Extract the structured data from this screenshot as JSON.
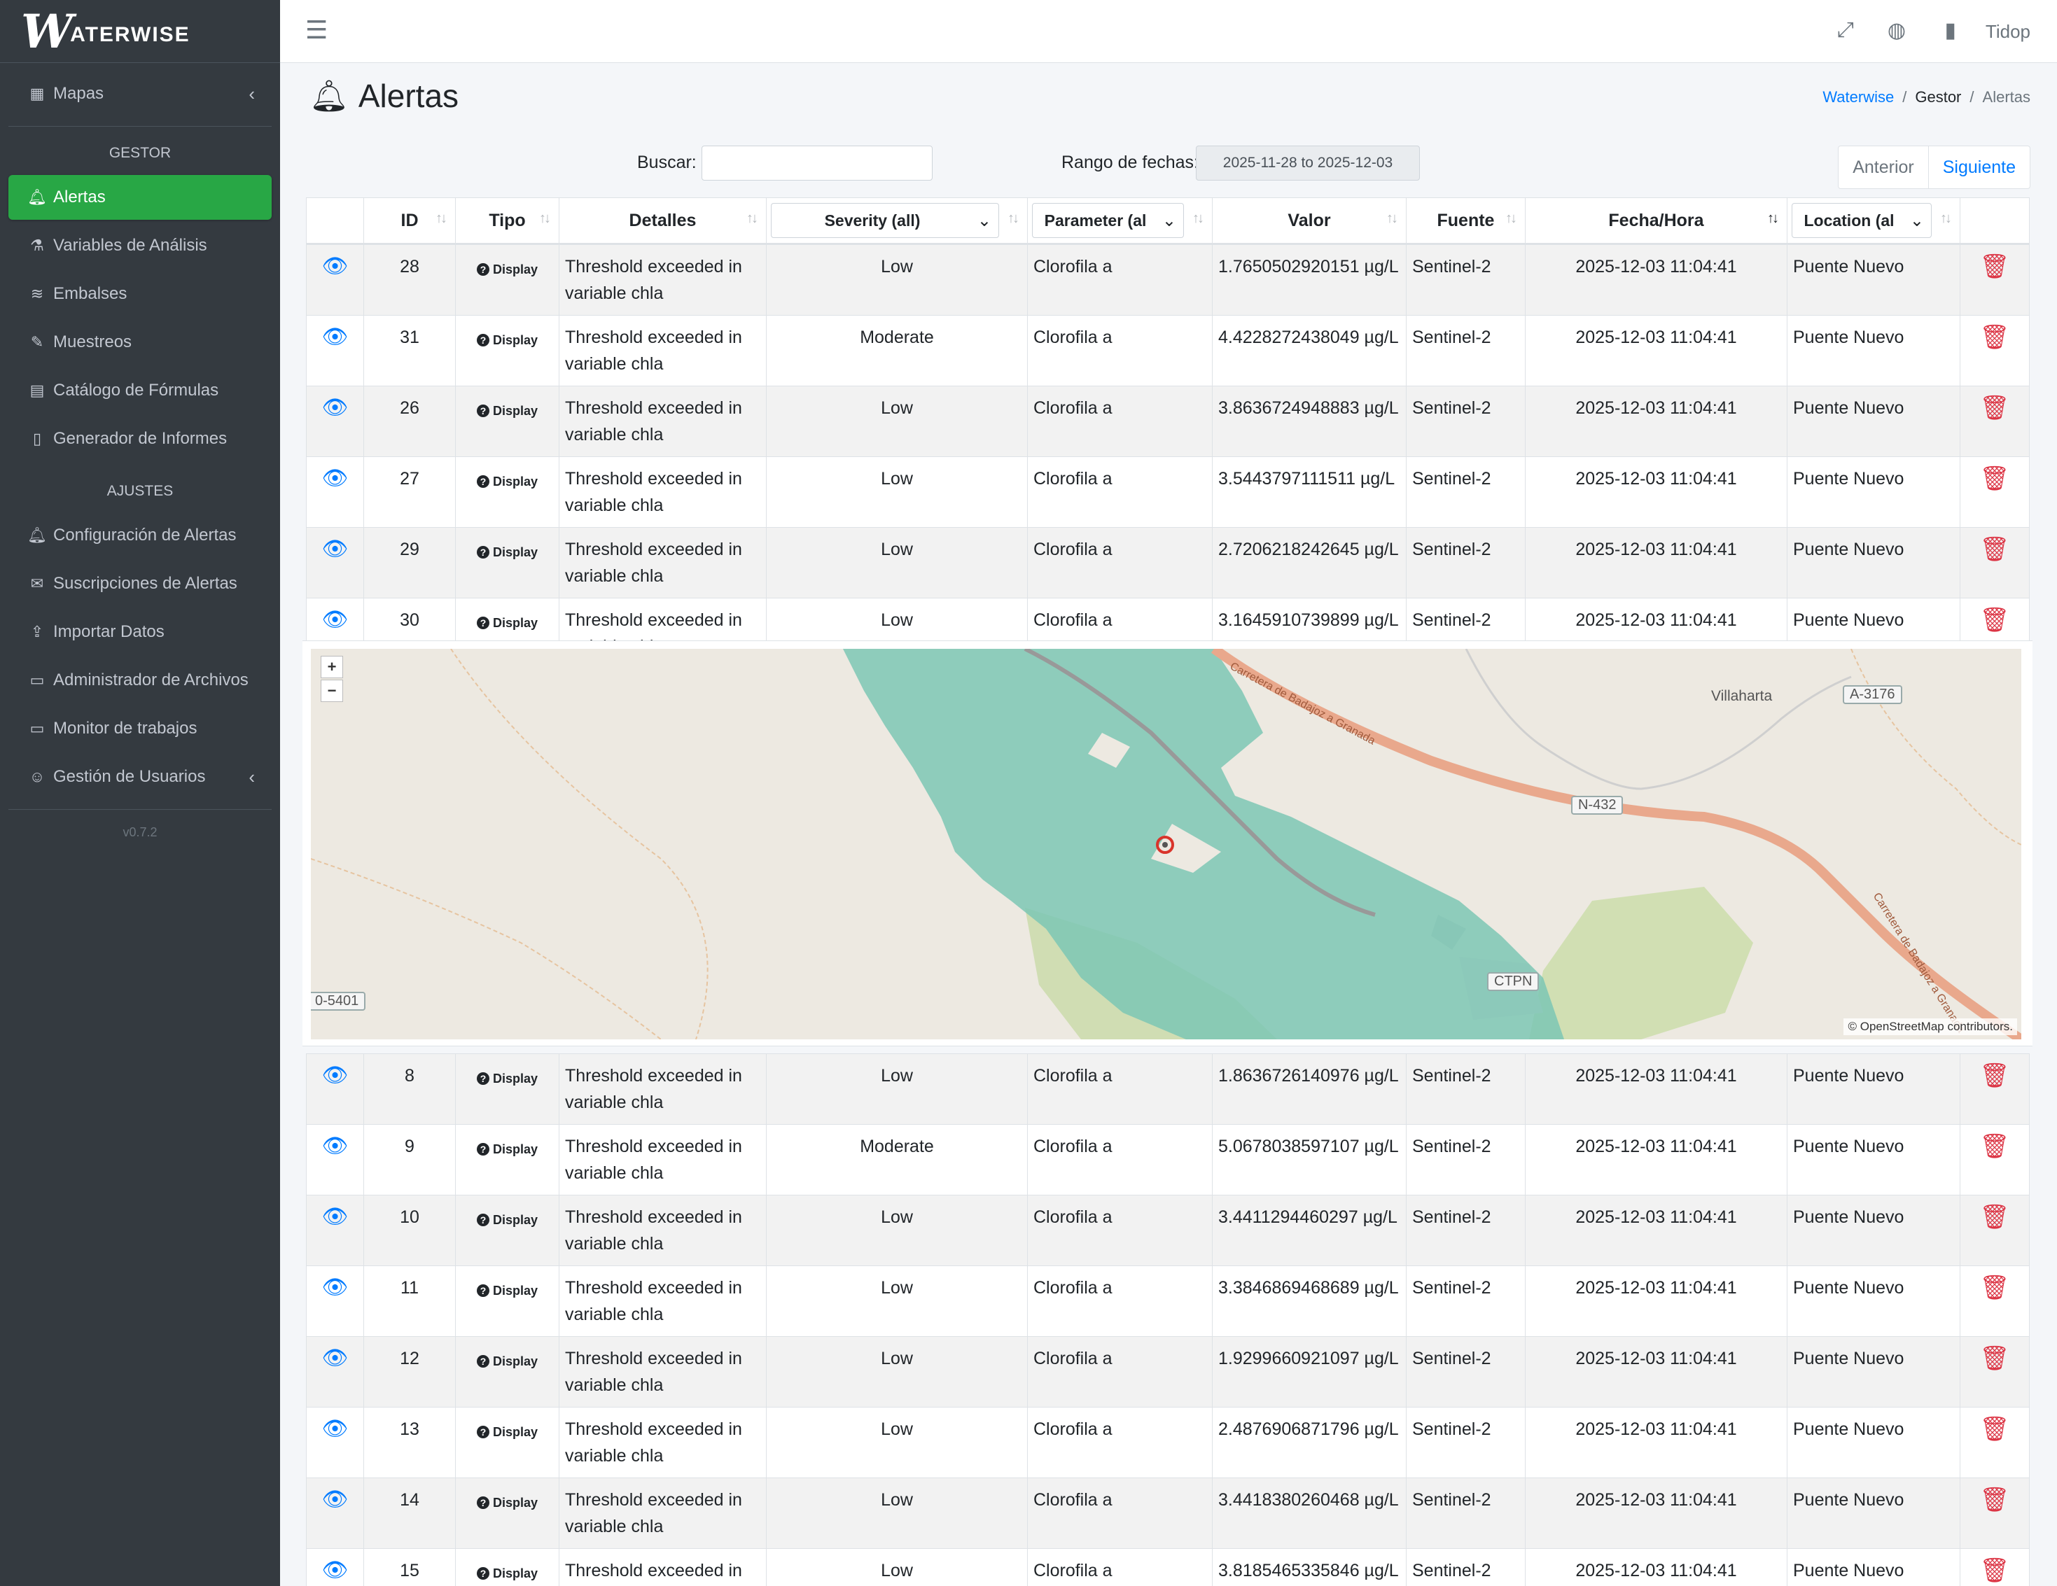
{
  "brand": {
    "logo_mark": "W",
    "logo_text": "ATERWISE"
  },
  "sidebar": {
    "top_items": [
      {
        "label": "Mapas",
        "icon": "map-icon"
      }
    ],
    "section_gestor": "GESTOR",
    "gestor_items": [
      {
        "label": "Alertas",
        "icon": "bell-icon",
        "active": true
      },
      {
        "label": "Variables de Análisis",
        "icon": "flask-icon"
      },
      {
        "label": "Embalses",
        "icon": "water-icon"
      },
      {
        "label": "Muestreos",
        "icon": "eyedropper-icon"
      },
      {
        "label": "Catálogo de Fórmulas",
        "icon": "calculator-icon"
      },
      {
        "label": "Generador de Informes",
        "icon": "file-icon"
      }
    ],
    "section_ajustes": "AJUSTES",
    "ajustes_items": [
      {
        "label": "Configuración de Alertas",
        "icon": "bell-icon"
      },
      {
        "label": "Suscripciones de Alertas",
        "icon": "envelope-icon"
      },
      {
        "label": "Importar Datos",
        "icon": "upload-icon"
      },
      {
        "label": "Administrador de Archivos",
        "icon": "folder-icon"
      },
      {
        "label": "Monitor de trabajos",
        "icon": "monitor-icon"
      },
      {
        "label": "Gestión de Usuarios",
        "icon": "users-icon"
      }
    ],
    "version": "v0.7.2"
  },
  "topbar": {
    "user": "Tidop"
  },
  "page": {
    "title": "Alertas",
    "breadcrumb": [
      "Waterwise",
      "Gestor",
      "Alertas"
    ]
  },
  "filters": {
    "search_label": "Buscar:",
    "search_value": "",
    "date_label": "Rango de fechas:",
    "date_value": "2025-11-28 to 2025-12-03"
  },
  "pager": {
    "prev": "Anterior",
    "next": "Siguiente"
  },
  "table": {
    "headers": {
      "id": "ID",
      "tipo": "Tipo",
      "detalles": "Detalles",
      "severity": "Severity (all)",
      "parameter": "Parameter (al",
      "valor": "Valor",
      "fuente": "Fuente",
      "fecha": "Fecha/Hora",
      "location": "Location (al"
    },
    "tipo_badge": "Display",
    "rows_top": [
      {
        "id": "28",
        "detalles": "Threshold exceeded in variable chla",
        "severity": "Low",
        "parameter": "Clorofila a",
        "valor": "1.7650502920151 µg/L",
        "fuente": "Sentinel-2",
        "fecha": "2025-12-03 11:04:41",
        "location": "Puente Nuevo"
      },
      {
        "id": "31",
        "detalles": "Threshold exceeded in variable chla",
        "severity": "Moderate",
        "parameter": "Clorofila a",
        "valor": "4.4228272438049 µg/L",
        "fuente": "Sentinel-2",
        "fecha": "2025-12-03 11:04:41",
        "location": "Puente Nuevo"
      },
      {
        "id": "26",
        "detalles": "Threshold exceeded in variable chla",
        "severity": "Low",
        "parameter": "Clorofila a",
        "valor": "3.8636724948883 µg/L",
        "fuente": "Sentinel-2",
        "fecha": "2025-12-03 11:04:41",
        "location": "Puente Nuevo"
      },
      {
        "id": "27",
        "detalles": "Threshold exceeded in variable chla",
        "severity": "Low",
        "parameter": "Clorofila a",
        "valor": "3.5443797111511 µg/L",
        "fuente": "Sentinel-2",
        "fecha": "2025-12-03 11:04:41",
        "location": "Puente Nuevo"
      },
      {
        "id": "29",
        "detalles": "Threshold exceeded in variable chla",
        "severity": "Low",
        "parameter": "Clorofila a",
        "valor": "2.7206218242645 µg/L",
        "fuente": "Sentinel-2",
        "fecha": "2025-12-03 11:04:41",
        "location": "Puente Nuevo"
      },
      {
        "id": "30",
        "detalles": "Threshold exceeded in variable chla",
        "severity": "Low",
        "parameter": "Clorofila a",
        "valor": "3.1645910739899 µg/L",
        "fuente": "Sentinel-2",
        "fecha": "2025-12-03 11:04:41",
        "location": "Puente Nuevo"
      }
    ],
    "rows_bottom": [
      {
        "id": "8",
        "detalles": "Threshold exceeded in variable chla",
        "severity": "Low",
        "parameter": "Clorofila a",
        "valor": "1.8636726140976 µg/L",
        "fuente": "Sentinel-2",
        "fecha": "2025-12-03 11:04:41",
        "location": "Puente Nuevo"
      },
      {
        "id": "9",
        "detalles": "Threshold exceeded in variable chla",
        "severity": "Moderate",
        "parameter": "Clorofila a",
        "valor": "5.0678038597107 µg/L",
        "fuente": "Sentinel-2",
        "fecha": "2025-12-03 11:04:41",
        "location": "Puente Nuevo"
      },
      {
        "id": "10",
        "detalles": "Threshold exceeded in variable chla",
        "severity": "Low",
        "parameter": "Clorofila a",
        "valor": "3.4411294460297 µg/L",
        "fuente": "Sentinel-2",
        "fecha": "2025-12-03 11:04:41",
        "location": "Puente Nuevo"
      },
      {
        "id": "11",
        "detalles": "Threshold exceeded in variable chla",
        "severity": "Low",
        "parameter": "Clorofila a",
        "valor": "3.3846869468689 µg/L",
        "fuente": "Sentinel-2",
        "fecha": "2025-12-03 11:04:41",
        "location": "Puente Nuevo"
      },
      {
        "id": "12",
        "detalles": "Threshold exceeded in variable chla",
        "severity": "Low",
        "parameter": "Clorofila a",
        "valor": "1.9299660921097 µg/L",
        "fuente": "Sentinel-2",
        "fecha": "2025-12-03 11:04:41",
        "location": "Puente Nuevo"
      },
      {
        "id": "13",
        "detalles": "Threshold exceeded in variable chla",
        "severity": "Low",
        "parameter": "Clorofila a",
        "valor": "2.4876906871796 µg/L",
        "fuente": "Sentinel-2",
        "fecha": "2025-12-03 11:04:41",
        "location": "Puente Nuevo"
      },
      {
        "id": "14",
        "detalles": "Threshold exceeded in variable chla",
        "severity": "Low",
        "parameter": "Clorofila a",
        "valor": "3.4418380260468 µg/L",
        "fuente": "Sentinel-2",
        "fecha": "2025-12-03 11:04:41",
        "location": "Puente Nuevo"
      },
      {
        "id": "15",
        "detalles": "Threshold exceeded in variable chla",
        "severity": "Low",
        "parameter": "Clorofila a",
        "valor": "3.8185465335846 µg/L",
        "fuente": "Sentinel-2",
        "fecha": "2025-12-03 11:04:41",
        "location": "Puente Nuevo"
      }
    ]
  },
  "map": {
    "zoom_in": "+",
    "zoom_out": "−",
    "attribution": "© OpenStreetMap contributors.",
    "labels": {
      "town": "Villaharta",
      "road_a3176": "A-3176",
      "road_n432": "N-432",
      "ctpn": "CTPN",
      "road_5401": "0-5401",
      "road_name_1": "Carretera de Badajoz a Granada",
      "road_name_2": "Carretera de Badajoz a Granada"
    }
  },
  "colors": {
    "sidebar_bg": "#343a40",
    "active_green": "#28a745",
    "link_blue": "#007bff",
    "danger_red": "#dc3545",
    "water_teal": "#7cc7b4"
  }
}
